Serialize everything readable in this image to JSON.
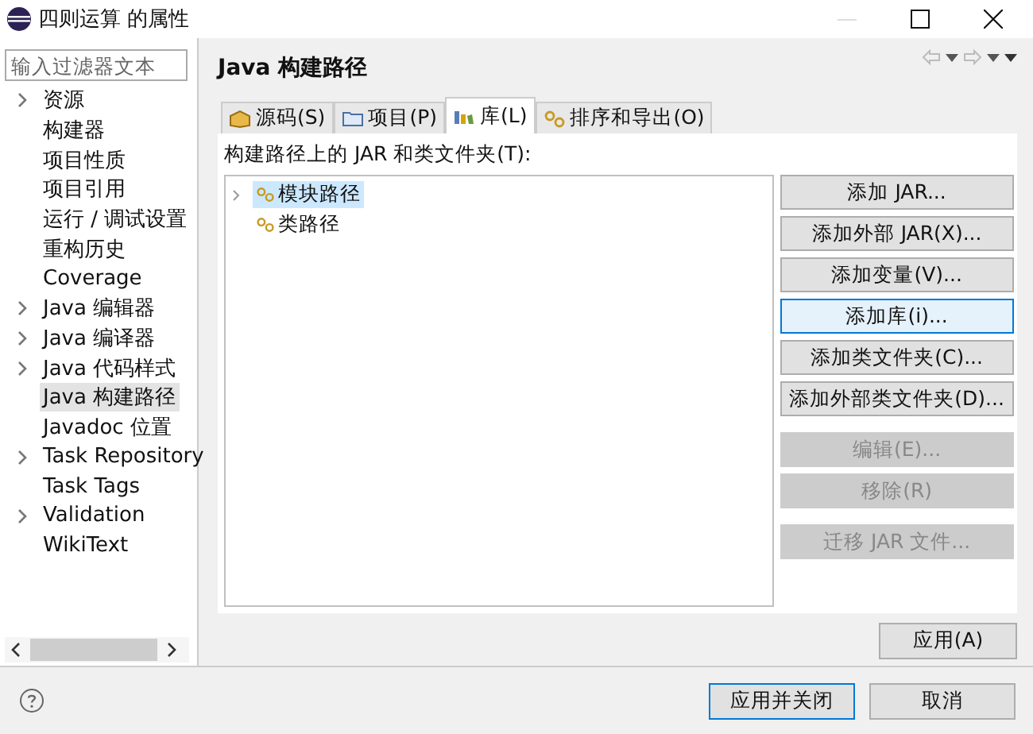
{
  "window": {
    "title": "四则运算 的属性"
  },
  "filter": {
    "placeholder": "输入过滤器文本"
  },
  "sidebar": {
    "items": [
      {
        "label": "资源",
        "expandable": true,
        "selected": false
      },
      {
        "label": "构建器",
        "expandable": false,
        "selected": false
      },
      {
        "label": "项目性质",
        "expandable": false,
        "selected": false
      },
      {
        "label": "项目引用",
        "expandable": false,
        "selected": false
      },
      {
        "label": "运行 / 调试设置",
        "expandable": false,
        "selected": false
      },
      {
        "label": "重构历史",
        "expandable": false,
        "selected": false
      },
      {
        "label": "Coverage",
        "expandable": false,
        "selected": false
      },
      {
        "label": "Java 编辑器",
        "expandable": true,
        "selected": false
      },
      {
        "label": "Java 编译器",
        "expandable": true,
        "selected": false
      },
      {
        "label": "Java 代码样式",
        "expandable": true,
        "selected": false
      },
      {
        "label": "Java 构建路径",
        "expandable": false,
        "selected": true
      },
      {
        "label": "Javadoc 位置",
        "expandable": false,
        "selected": false
      },
      {
        "label": "Task Repository",
        "expandable": true,
        "selected": false
      },
      {
        "label": "Task Tags",
        "expandable": false,
        "selected": false
      },
      {
        "label": "Validation",
        "expandable": true,
        "selected": false
      },
      {
        "label": "WikiText",
        "expandable": false,
        "selected": false
      }
    ]
  },
  "page": {
    "title": "Java 构建路径",
    "tabs": [
      {
        "label": "源码(S)",
        "selected": false
      },
      {
        "label": "项目(P)",
        "selected": false
      },
      {
        "label": "库(L)",
        "selected": true
      },
      {
        "label": "排序和导出(O)",
        "selected": false
      }
    ],
    "list_label": "构建路径上的 JAR 和类文件夹(T):",
    "tree": [
      {
        "label": "模块路径",
        "expandable": true,
        "selected": true
      },
      {
        "label": "类路径",
        "expandable": false,
        "selected": false
      }
    ],
    "button_groups": [
      [
        {
          "label": "添加 JAR...",
          "disabled": false,
          "focused": false
        },
        {
          "label": "添加外部 JAR(X)...",
          "disabled": false,
          "focused": false
        },
        {
          "label": "添加变量(V)...",
          "disabled": false,
          "focused": false
        },
        {
          "label": "添加库(i)...",
          "disabled": false,
          "focused": true
        },
        {
          "label": "添加类文件夹(C)...",
          "disabled": false,
          "focused": false
        },
        {
          "label": "添加外部类文件夹(D)...",
          "disabled": false,
          "focused": false
        }
      ],
      [
        {
          "label": "编辑(E)...",
          "disabled": true,
          "focused": false
        },
        {
          "label": "移除(R)",
          "disabled": true,
          "focused": false
        }
      ],
      [
        {
          "label": "迁移 JAR 文件...",
          "disabled": true,
          "focused": false
        }
      ]
    ],
    "apply": "应用(A)"
  },
  "footer": {
    "buttons": [
      {
        "label": "应用并关闭",
        "default": true
      },
      {
        "label": "取消",
        "default": false
      }
    ]
  }
}
